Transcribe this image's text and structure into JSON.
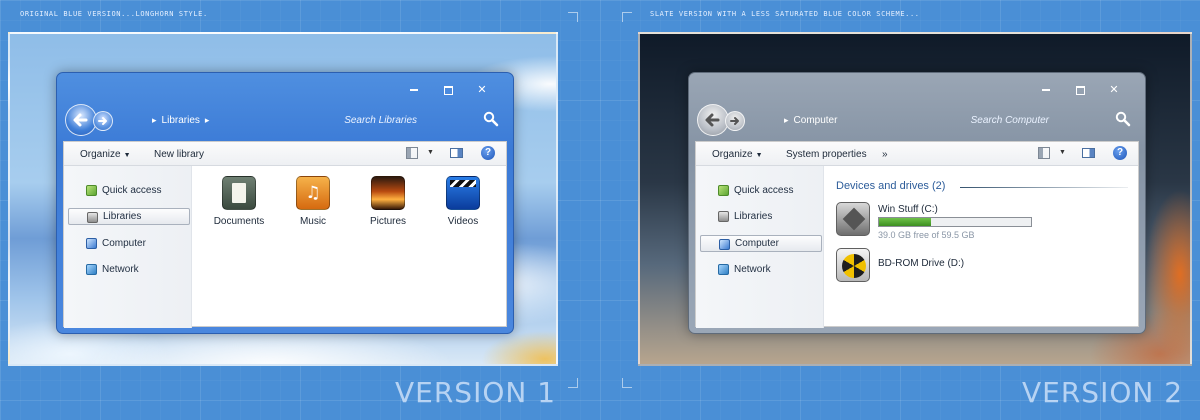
{
  "captions": {
    "left": "ORIGINAL BLUE VERSION...LONGHORN STYLE.",
    "right": "SLATE VERSION WITH A LESS SATURATED BLUE COLOR SCHEME...",
    "version1": "VERSION 1",
    "version2": "VERSION 2"
  },
  "colors": {
    "background": "#4a8fd6",
    "v1_frame": "#3b7ad6",
    "v2_frame": "#8593a4",
    "selection_border": "#a9b1bd",
    "drive_bar_fill": "#4ea52c"
  },
  "window1": {
    "controls": {
      "minimize": "minimize-icon",
      "maximize": "maximize-icon",
      "close": "✕"
    },
    "address": {
      "path": "Libraries"
    },
    "search_placeholder": "Search Libraries",
    "toolbar": {
      "organize": "Organize",
      "new_library": "New library"
    },
    "nav_items": [
      {
        "label": "Quick access",
        "icon": "quick-access-icon"
      },
      {
        "label": "Libraries",
        "icon": "libraries-icon",
        "selected": true
      },
      {
        "label": "Computer",
        "icon": "computer-icon"
      },
      {
        "label": "Network",
        "icon": "network-icon"
      }
    ],
    "libraries": [
      {
        "label": "Documents",
        "icon": "documents-icon"
      },
      {
        "label": "Music",
        "icon": "music-icon"
      },
      {
        "label": "Pictures",
        "icon": "pictures-icon"
      },
      {
        "label": "Videos",
        "icon": "videos-icon"
      }
    ]
  },
  "window2": {
    "controls": {
      "minimize": "minimize-icon",
      "maximize": "maximize-icon",
      "close": "✕"
    },
    "address": {
      "path": "Computer"
    },
    "search_placeholder": "Search Computer",
    "toolbar": {
      "organize": "Organize",
      "system_properties": "System properties",
      "more": "»"
    },
    "nav_items": [
      {
        "label": "Quick access",
        "icon": "quick-access-icon"
      },
      {
        "label": "Libraries",
        "icon": "libraries-icon"
      },
      {
        "label": "Computer",
        "icon": "computer-icon",
        "selected": true
      },
      {
        "label": "Network",
        "icon": "network-icon"
      }
    ],
    "devices_heading": "Devices and drives (2)",
    "drives": [
      {
        "name": "Win Stuff (C:)",
        "free_text": "39.0 GB free of 59.5 GB",
        "used_fraction": 0.345,
        "icon": "hard-drive-icon"
      },
      {
        "name": "BD-ROM Drive (D:)",
        "icon": "bd-rom-icon"
      }
    ]
  }
}
